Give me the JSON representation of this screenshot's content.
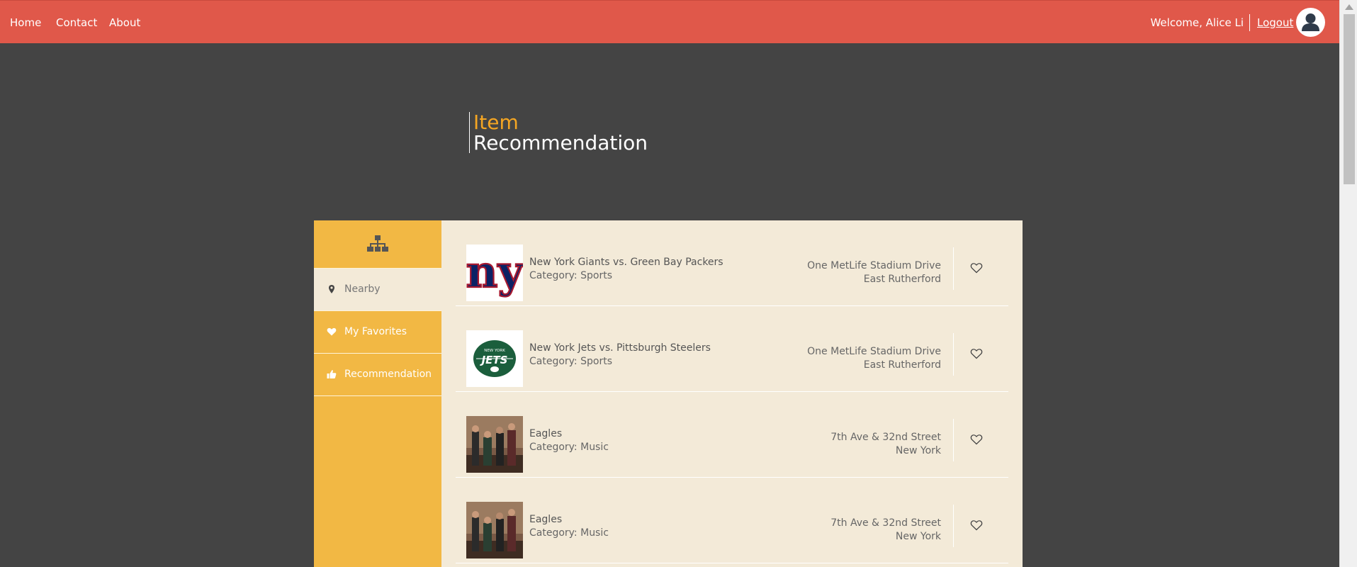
{
  "nav": {
    "links": [
      "Home",
      "Contact",
      "About"
    ],
    "welcome": "Welcome, Alice Li",
    "logout": "Logout"
  },
  "heading": {
    "line1": "Item",
    "line2": "Recommendation"
  },
  "sidebar": {
    "top_icon": "sitemap-icon",
    "items": [
      {
        "label": "Nearby",
        "icon": "map-marker-icon",
        "active": true
      },
      {
        "label": "My Favorites",
        "icon": "heart-icon",
        "active": false
      },
      {
        "label": "Recommendation",
        "icon": "thumbs-up-icon",
        "active": false
      }
    ]
  },
  "items": [
    {
      "name": "New York Giants vs. Green Bay Packers",
      "category_label": "Category:",
      "category": "Sports",
      "address_line1": "One MetLife Stadium Drive",
      "address_line2": "East Rutherford",
      "thumb": "giants-logo"
    },
    {
      "name": "New York Jets vs. Pittsburgh Steelers",
      "category_label": "Category:",
      "category": "Sports",
      "address_line1": "One MetLife Stadium Drive",
      "address_line2": "East Rutherford",
      "thumb": "jets-logo"
    },
    {
      "name": "Eagles",
      "category_label": "Category:",
      "category": "Music",
      "address_line1": "7th Ave & 32nd Street",
      "address_line2": "New York",
      "thumb": "band-photo"
    },
    {
      "name": "Eagles",
      "category_label": "Category:",
      "category": "Music",
      "address_line1": "7th Ave & 32nd Street",
      "address_line2": "New York",
      "thumb": "band-photo"
    }
  ],
  "colors": {
    "nav_bg": "#e0584a",
    "page_bg": "#444444",
    "sidebar_bg": "#f2b844",
    "content_bg": "#f3ead8",
    "heading_accent": "#f5a623"
  }
}
